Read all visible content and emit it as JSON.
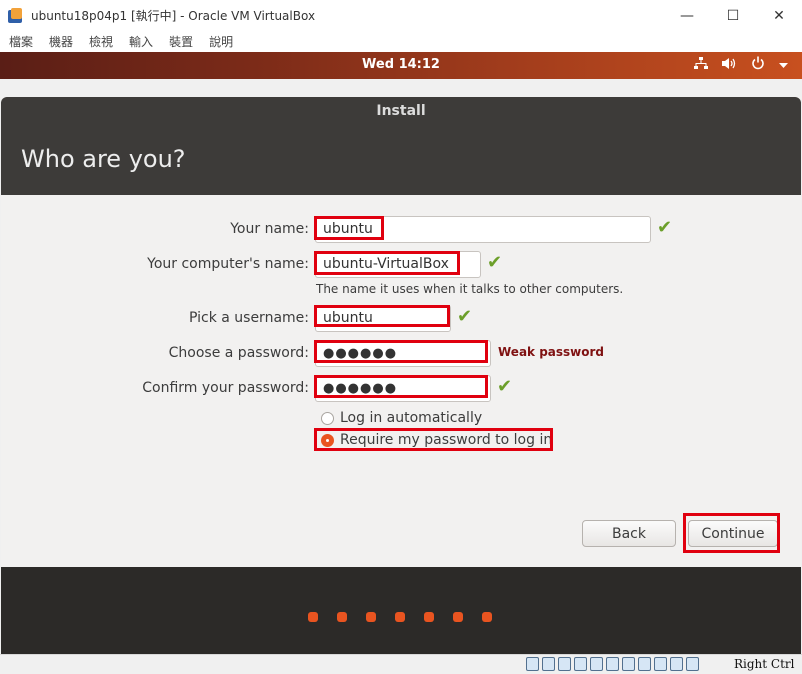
{
  "window": {
    "title": "ubuntu18p04p1 [執行中] - Oracle VM VirtualBox",
    "minimize": "—",
    "maximize": "☐",
    "close": "✕"
  },
  "menu": [
    "檔案",
    "機器",
    "檢視",
    "輸入",
    "裝置",
    "說明"
  ],
  "topbar": {
    "clock": "Wed 14:12",
    "network_icon": "network-icon",
    "volume_icon": "volume-icon",
    "power_icon": "power-icon"
  },
  "installer": {
    "title": "Install",
    "heading": "Who are you?",
    "fields": {
      "name": {
        "label": "Your name:",
        "value": "ubuntu"
      },
      "computer": {
        "label": "Your computer's name:",
        "value": "ubuntu-VirtualBox",
        "hint": "The name it uses when it talks to other computers."
      },
      "username": {
        "label": "Pick a username:",
        "value": "ubuntu"
      },
      "password": {
        "label": "Choose a password:",
        "value": "●●●●●●",
        "strength": "Weak password"
      },
      "confirm": {
        "label": "Confirm your password:",
        "value": "●●●●●●"
      }
    },
    "login_options": {
      "auto": "Log in automatically",
      "require": "Require my password to log in",
      "selected": "require"
    },
    "buttons": {
      "back": "Back",
      "continue": "Continue"
    },
    "progress": {
      "total_steps": 7
    }
  },
  "statusbar": {
    "host_key": "Right Ctrl"
  },
  "colors": {
    "accent": "#e95420",
    "highlight": "#e0000f",
    "check": "#6c9f2a",
    "weak": "#7f1111"
  }
}
